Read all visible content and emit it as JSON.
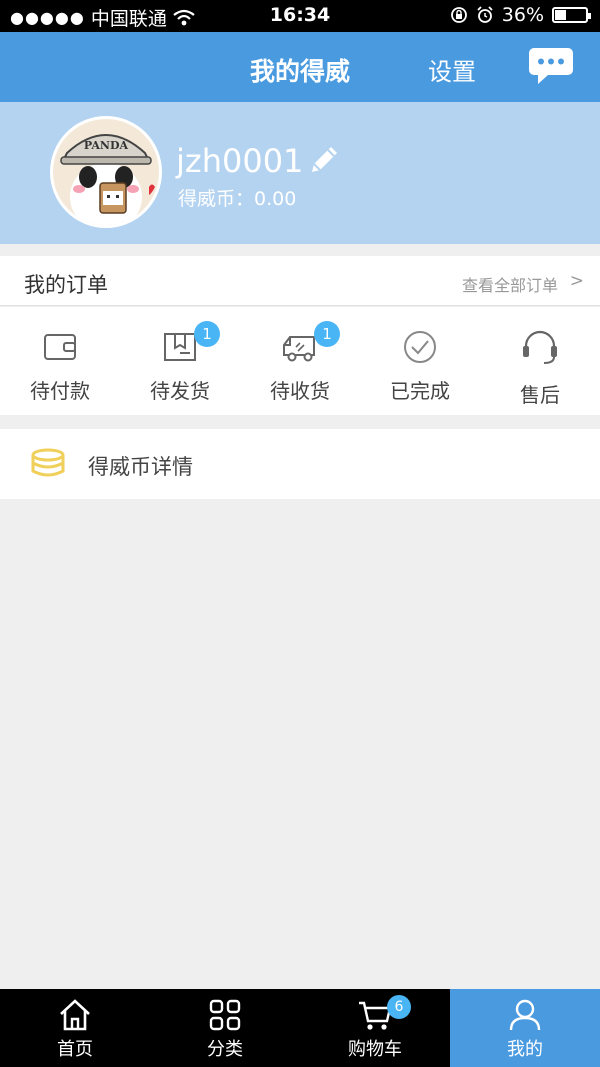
{
  "status_bar": {
    "signal": "●●●●●",
    "carrier": "中国联通",
    "time": "16:34",
    "battery_percent": "36%",
    "battery_level": 0.36
  },
  "nav": {
    "title": "我的得威",
    "settings_label": "设置",
    "message_icon": "chat-bubble-icon"
  },
  "profile": {
    "username": "jzh0001",
    "coins_label": "得威币：0.00",
    "avatar_text": "PANDA"
  },
  "orders": {
    "title": "我的订单",
    "view_all": "查看全部订单",
    "arrow": ">",
    "items": [
      {
        "label": "待付款",
        "icon": "wallet-icon",
        "badge": ""
      },
      {
        "label": "待发货",
        "icon": "package-icon",
        "badge": "1"
      },
      {
        "label": "待收货",
        "icon": "truck-icon",
        "badge": "1"
      },
      {
        "label": "已完成",
        "icon": "check-circle-icon",
        "badge": ""
      },
      {
        "label": "售后",
        "icon": "headset-icon",
        "badge": ""
      }
    ]
  },
  "coin_detail": {
    "label": "得威币详情",
    "icon": "coin-stack-icon"
  },
  "tab_bar": {
    "items": [
      {
        "label": "首页",
        "icon": "home-icon",
        "badge": ""
      },
      {
        "label": "分类",
        "icon": "grid-icon",
        "badge": ""
      },
      {
        "label": "购物车",
        "icon": "cart-icon",
        "badge": "6"
      },
      {
        "label": "我的",
        "icon": "user-icon",
        "badge": ""
      }
    ],
    "active_index": 3
  },
  "colors": {
    "brand_blue": "#4a9ae0",
    "profile_bg": "#b4d3f0",
    "badge_blue": "#4ab5f5",
    "coin_yellow": "#f0cf5a"
  }
}
